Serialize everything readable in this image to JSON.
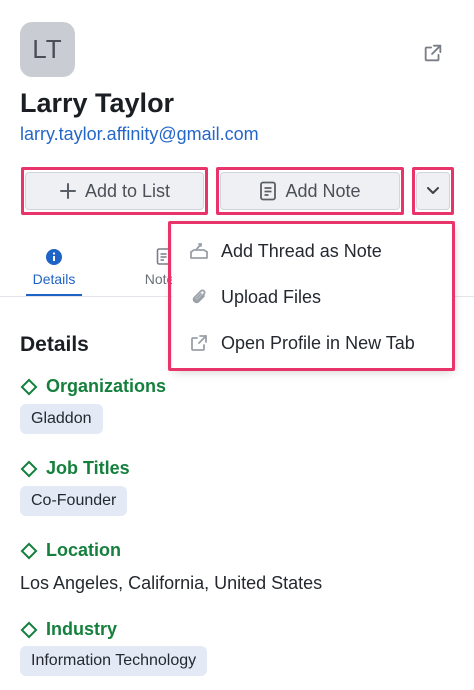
{
  "profile": {
    "initials": "LT",
    "name": "Larry Taylor",
    "email": "larry.taylor.affinity@gmail.com"
  },
  "actions": {
    "add_to_list": "Add to List",
    "add_note": "Add Note"
  },
  "tabs": [
    {
      "label": "Details",
      "active": true
    },
    {
      "label": "Notes",
      "active": false
    }
  ],
  "dropdown": {
    "items": [
      {
        "label": "Add Thread as Note",
        "icon": "thread-note-icon"
      },
      {
        "label": "Upload Files",
        "icon": "paperclip-icon"
      },
      {
        "label": "Open Profile in New Tab",
        "icon": "external-link-icon"
      }
    ]
  },
  "details": {
    "title": "Details",
    "fields": [
      {
        "label": "Organizations",
        "value": "Gladdon"
      },
      {
        "label": "Job Titles",
        "value": "Co-Founder"
      },
      {
        "label": "Location",
        "value": "Los Angeles, California, United States"
      },
      {
        "label": "Industry",
        "value": "Information Technology"
      }
    ]
  },
  "colors": {
    "accent_blue": "#1f63c6",
    "link_blue": "#2467c9",
    "field_green": "#15803d",
    "highlight_pink": "#e8336b",
    "chip_bg": "#e3eaf5"
  }
}
